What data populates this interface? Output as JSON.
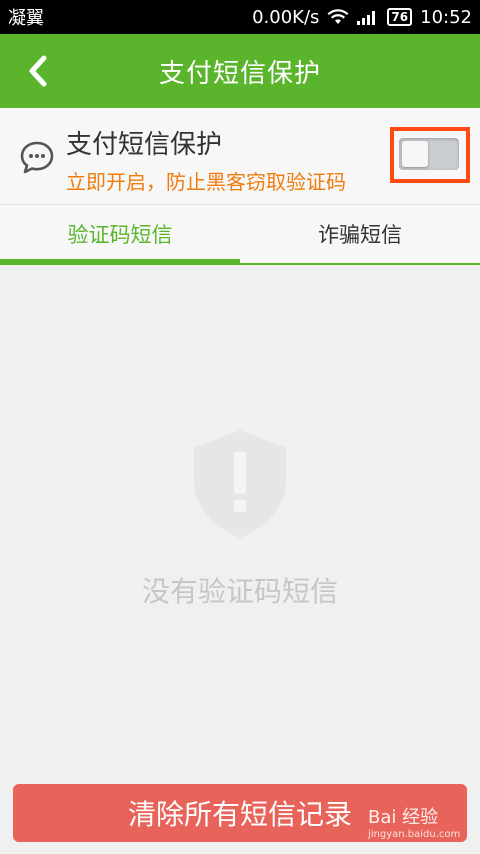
{
  "statusbar": {
    "carrier": "凝翼",
    "speed": "0.00K/s",
    "battery": "76",
    "time": "10:52"
  },
  "header": {
    "title": "支付短信保护"
  },
  "protection": {
    "title": "支付短信保护",
    "subtitle": "立即开启，防止黑客窃取验证码",
    "toggle_on": false
  },
  "tabs": [
    {
      "label": "验证码短信",
      "active": true
    },
    {
      "label": "诈骗短信",
      "active": false
    }
  ],
  "empty_state": {
    "text": "没有验证码短信"
  },
  "footer": {
    "clear_button": "清除所有短信记录"
  },
  "watermark": {
    "brand": "Bai 经验",
    "url": "jingyan.baidu.com"
  },
  "colors": {
    "accent": "#5ab52c",
    "warning": "#f07c0e",
    "danger_button": "#e8635a",
    "highlight": "#ff4a14"
  }
}
